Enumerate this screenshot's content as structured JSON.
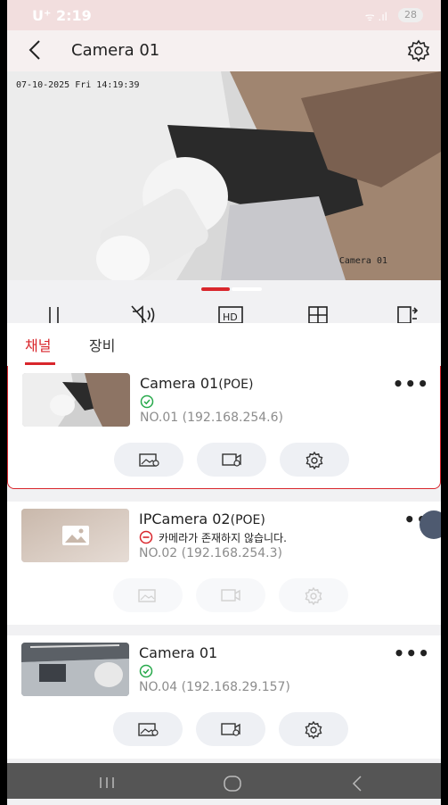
{
  "status_bar": {
    "carrier_time": "U⁺ 2:19",
    "signal": "ᯤ .ıl",
    "battery": "28"
  },
  "header": {
    "title": "Camera 01"
  },
  "live_view": {
    "osd_datetime": "07-10-2025 Fri 14:19:39",
    "osd_camera_name": "Camera 01"
  },
  "controls": {
    "icons": [
      "pause-icon",
      "mute-icon",
      "hd-icon",
      "grid-icon",
      "switch-window-icon"
    ]
  },
  "tabs": {
    "channel": "채널",
    "device": "장비"
  },
  "cameras": [
    {
      "name": "Camera 01",
      "tag": "(POE)",
      "status": "online",
      "status_text": "",
      "address": "NO.01 (192.168.254.6)"
    },
    {
      "name": "IPCamera 02",
      "tag": "(POE)",
      "status": "offline",
      "status_text": "카메라가 존재하지 않습니다.",
      "address": "NO.02 (192.168.254.3)"
    },
    {
      "name": "Camera 01",
      "tag": "",
      "status": "online",
      "status_text": "",
      "address": "NO.04 (192.168.29.157)"
    }
  ],
  "colors": {
    "accent": "#d9262c",
    "online": "#27a94b",
    "offline": "#d9262c"
  }
}
